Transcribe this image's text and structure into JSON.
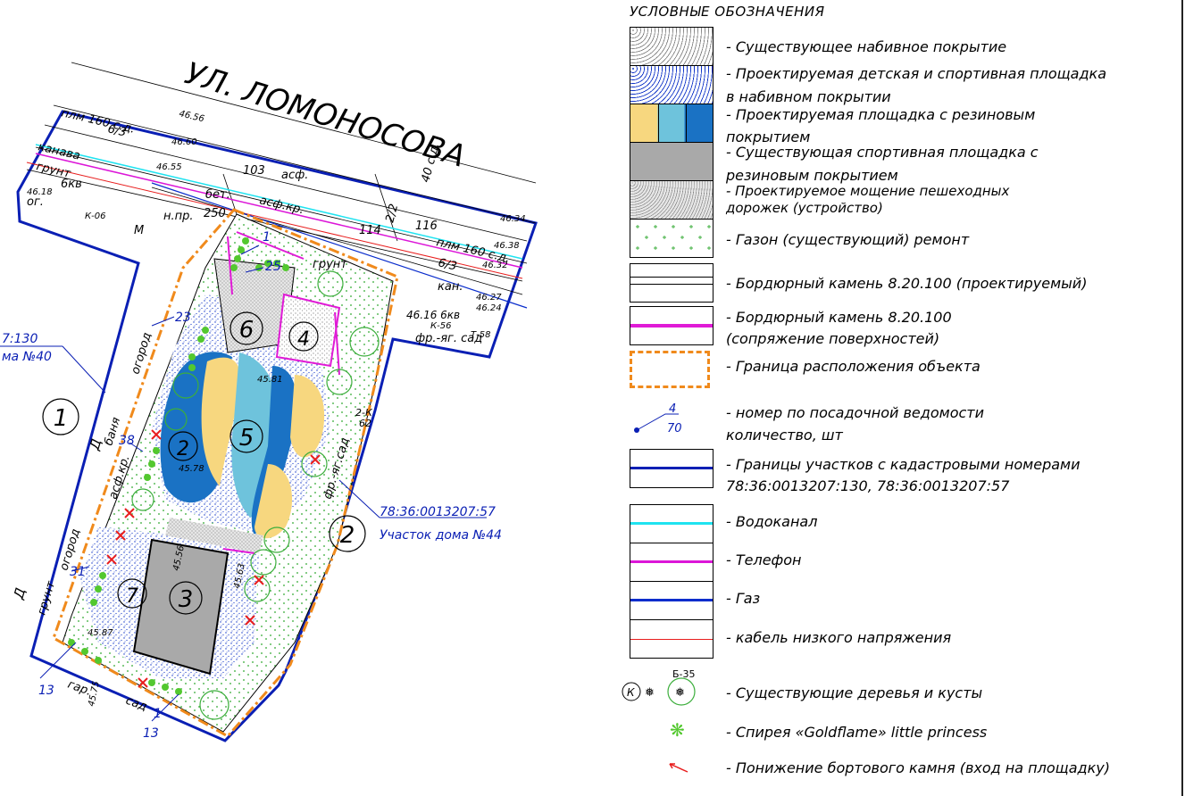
{
  "plan": {
    "street": "УЛ. ЛОМОНОСОВА",
    "zone1": "1",
    "zone2": "2",
    "zone3": "3",
    "zone4": "4",
    "zone5": "5",
    "zone6": "6",
    "zone7": "7",
    "zone2b": "2",
    "plot_left_num": "7:130",
    "plot_left_name": "ма №40",
    "plot_right_num": "78:36:0013207:57",
    "plot_right_name": "Участок дома №44",
    "road_labels": {
      "plm": "плм 160 с.д.",
      "kanava": "канава",
      "grunt": "грунт",
      "r63": "6/3",
      "h46_56": "46.56",
      "h46_60": "46.60",
      "h46_55": "46.55",
      "h103": "103",
      "asf": "асф.",
      "asfkr": "асф.кр.",
      "bet": "бет.",
      "npr": "н.пр.",
      "h250": "250",
      "h114": "114",
      "h116": "116",
      "plm_r": "плм 160 с.д.",
      "r63b": "6/3",
      "h46_34": "46.34",
      "h46_38": "46.38",
      "h46_32": "46.32",
      "kan": "кан.",
      "h46_27": "46.27",
      "h46_24": "46.24",
      "h46_16": "46.16 6кв",
      "frsad": "фр.-яг. сад",
      "k56": "К-56",
      "t58": "Т-58",
      "h40sd": "40 с.д.",
      "h22": "2/2",
      "k06": "К-06",
      "m": "М",
      "h46_18": "46.18",
      "og": "ог.",
      "h6kv": "6кв",
      "ogorod": "огород",
      "ogorod2": "огород",
      "banya": "баня",
      "asfkr2": "асф.кр.",
      "grunt2": "грунт",
      "grunt3": "грунт",
      "dd": "Д",
      "d2": "Д",
      "gar": "гар.",
      "sad": "сад",
      "frsad2": "фр.-яг.сад",
      "k62": "2-К",
      "k62b": "62",
      "h45_81": "45.81",
      "h45_78": "45.78",
      "h45_56": "45.56",
      "h45_63": "45.63",
      "h45_87": "45.87",
      "h45_75": "45.75"
    },
    "markers": {
      "m1a": "1",
      "m25": "25",
      "m23": "23",
      "m38": "38",
      "m31": "31",
      "m13a": "13",
      "m1b": "1",
      "m13b": "13"
    }
  },
  "legend": {
    "title": "УСЛОВНЫЕ ОБОЗНАЧЕНИЯ",
    "items": [
      {
        "text": "- Существующее набивное покрытие"
      },
      {
        "text": "- Проектируемая детская и спортивная площадка",
        "text2": "в набивном покрытии"
      },
      {
        "text": "- Проектируемая площадка с резиновым",
        "text2": "покрытием"
      },
      {
        "text": "- Существующая спортивная площадка с",
        "text2": "резиновым покрытием"
      },
      {
        "text": "- Проектируемое мощение пешеходных",
        "text2": "дорожек (устройство)"
      },
      {
        "text": "- Газон (существующий) ремонт"
      },
      {
        "text": "- Бордюрный камень 8.20.100 (проектируемый)"
      },
      {
        "text": "- Бордюрный камень 8.20.100",
        "text2": "(сопряжение поверхностей)"
      },
      {
        "text": "- Граница расположения объекта"
      },
      {
        "text": "- номер по посадочной ведомости",
        "text2": "количество, шт",
        "sym_top": "4",
        "sym_bot": "70"
      },
      {
        "text": "- Границы участков с кадастровыми номерами",
        "text2": "78:36:0013207:130, 78:36:0013207:57"
      },
      {
        "text": "- Водоканал"
      },
      {
        "text": "- Телефон"
      },
      {
        "text": "- Газ"
      },
      {
        "text": "- кабель низкого напряжения"
      },
      {
        "text": "- Существующие деревья и кусты",
        "sym_label": "Б-35"
      },
      {
        "text": "- Спирея «Goldflame» little princess"
      },
      {
        "text": "- Понижение бортового камня (вход на площадку)"
      }
    ],
    "colors": {
      "rubber_yellow": "#f7d77f",
      "rubber_lightblue": "#6ec3dc",
      "rubber_blue": "#1a72c4",
      "existing_rubber": "#a9a9a9",
      "curb_magenta": "#e01ad6",
      "object_boundary": "#f08a1c",
      "cadastral": "#0a1fb4",
      "vodokanal": "#1fe3f0",
      "telephone": "#dc16d8",
      "gas": "#0a2dcc",
      "cable": "#e81d1d",
      "lawn": "#3db53d",
      "spirea": "#53c82f"
    }
  }
}
